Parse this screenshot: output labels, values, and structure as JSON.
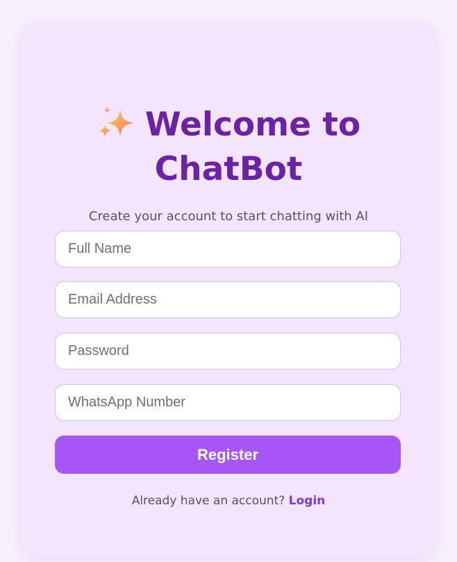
{
  "header": {
    "title_line1": "Welcome to",
    "title_line2": "ChatBot",
    "icon": "sparkles-icon",
    "subtitle": "Create your account to start chatting with AI"
  },
  "form": {
    "full_name": {
      "placeholder": "Full Name",
      "value": ""
    },
    "email": {
      "placeholder": "Email Address",
      "value": ""
    },
    "password": {
      "placeholder": "Password",
      "value": ""
    },
    "whatsapp": {
      "placeholder": "WhatsApp Number",
      "value": ""
    },
    "register_label": "Register"
  },
  "footer": {
    "prompt": "Already have an account?",
    "login_label": "Login"
  },
  "colors": {
    "background": "#f8f0fe",
    "card": "#f3e5fd",
    "title": "#6b21a8",
    "button": "#a855f7",
    "link": "#7e3bd8"
  }
}
